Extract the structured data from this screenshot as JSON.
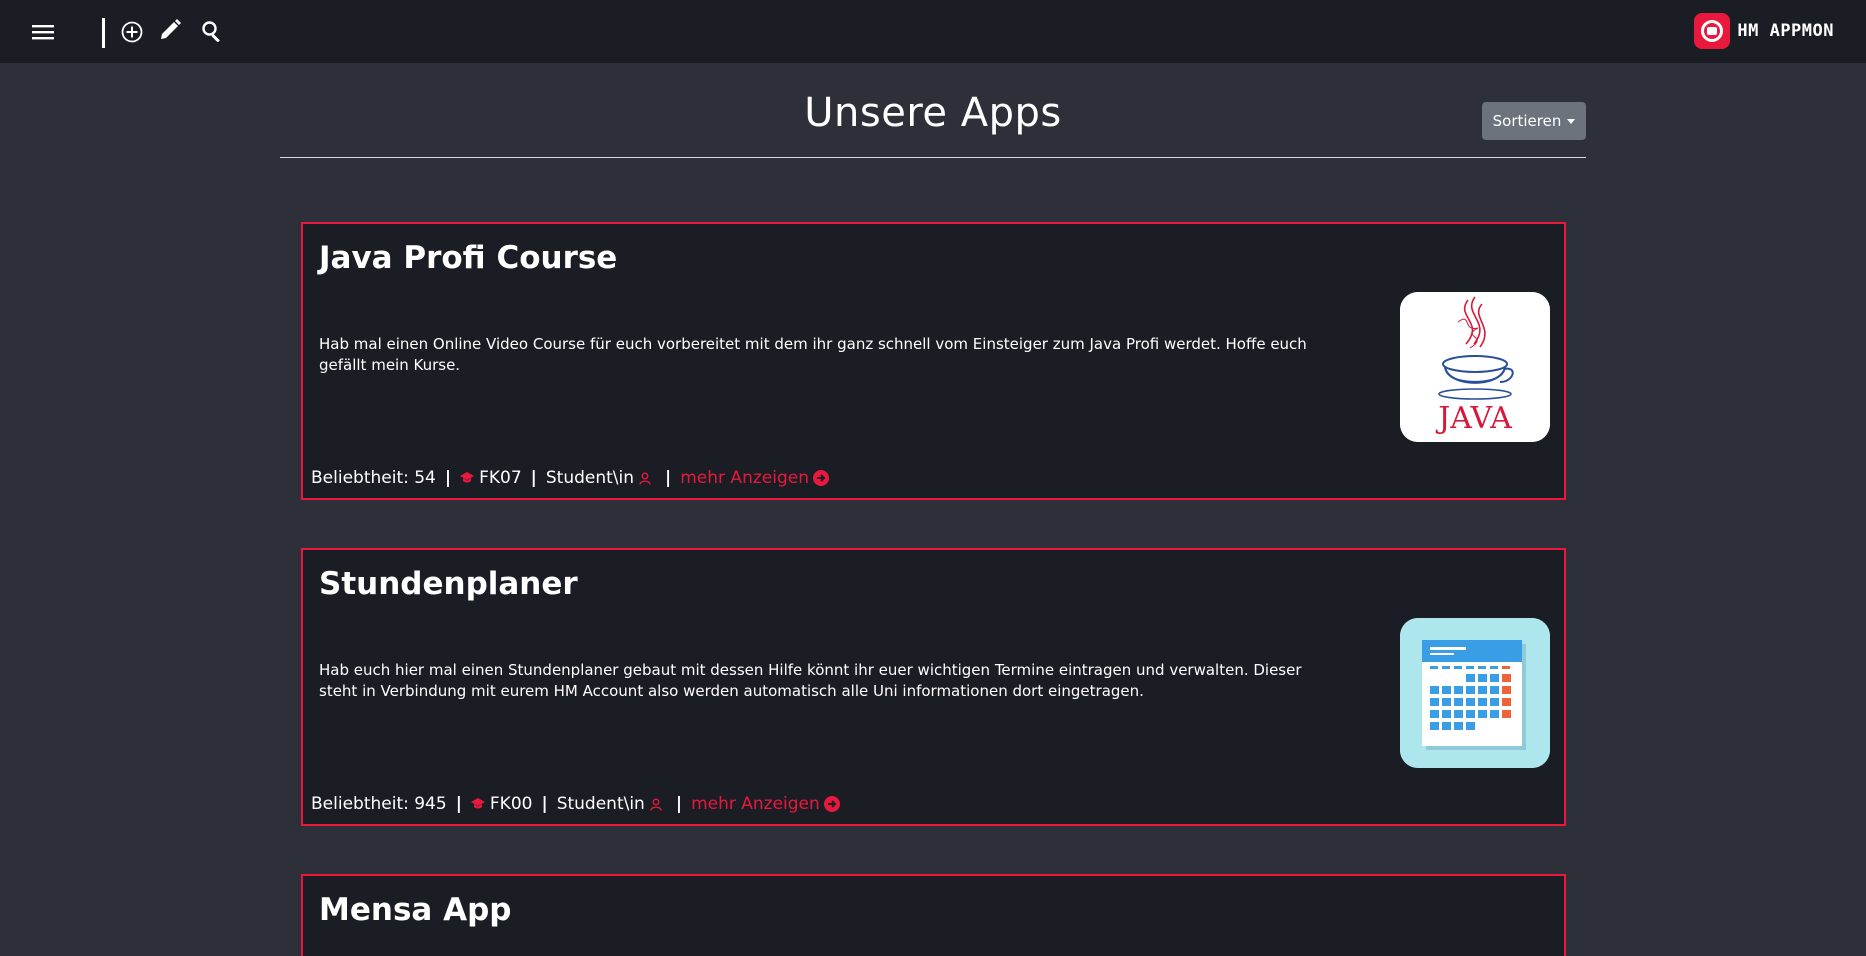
{
  "nav": {
    "menu_icon": "hamburger-menu-icon",
    "add_icon": "plus-circle-icon",
    "edit_icon": "pencil-icon",
    "search_icon": "search-icon",
    "brand_name": "HM APPMON",
    "brand_color": "#e8193c"
  },
  "header": {
    "title": "Unsere Apps",
    "sort_label": "Sortieren"
  },
  "apps": [
    {
      "title": "Java Profi Course",
      "description": "Hab mal einen Online Video Course für euch vorbereitet mit dem ihr ganz schnell vom Einsteiger zum Java Profi werdet. Hoffe euch gefällt mein Kurse.",
      "popularity": "Beliebtheit: 54",
      "faculty": "FK07",
      "audience": "Student\\in",
      "more_label": "mehr Anzeigen",
      "image_label": "JAVA"
    },
    {
      "title": "Stundenplaner",
      "description": "Hab euch hier mal einen Stundenplaner gebaut mit dessen Hilfe könnt ihr euer wichtigen Termine eintragen und verwalten. Dieser steht in Verbindung mit eurem HM Account also werden automatisch alle Uni informationen dort eingetragen.",
      "popularity": "Beliebtheit: 945",
      "faculty": "FK00",
      "audience": "Student\\in",
      "more_label": "mehr Anzeigen",
      "image_label": ""
    },
    {
      "title": "Mensa App"
    }
  ]
}
